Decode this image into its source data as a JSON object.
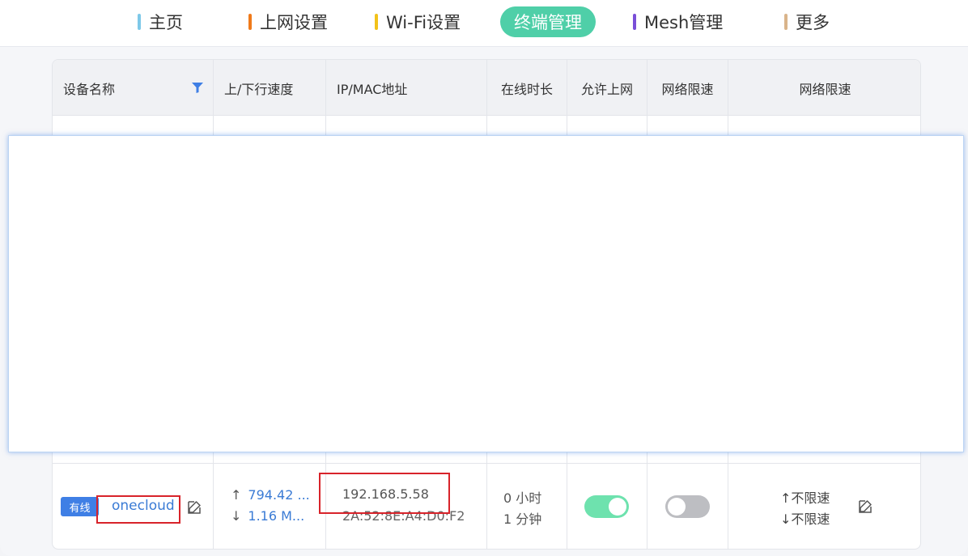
{
  "nav": {
    "items": [
      {
        "label": "主页",
        "color": "#7ec8e8"
      },
      {
        "label": "上网设置",
        "color": "#f07a1a"
      },
      {
        "label": "Wi-Fi设置",
        "color": "#f2c21a"
      },
      {
        "label": "终端管理",
        "color": "#4fcfa8",
        "active": true
      },
      {
        "label": "Mesh管理",
        "color": "#7a4fd8"
      },
      {
        "label": "更多",
        "color": "#d9b48a"
      }
    ]
  },
  "table": {
    "headers": {
      "device_name": "设备名称",
      "speed": "上/下行速度",
      "ip_mac": "IP/MAC地址",
      "online_time": "在线时长",
      "allow_internet": "允许上网",
      "rate_limit_toggle": "网络限速",
      "rate_limit": "网络限速"
    },
    "row": {
      "connection_tag": "有线",
      "device_name": "onecloud",
      "upload": "794.42 ...",
      "download": "1.16 M...",
      "ip": "192.168.5.58",
      "mac": "2A:52:8E:A4:D0:F2",
      "online_hours": "0 小时",
      "online_minutes": "1 分钟",
      "allow_internet": true,
      "rate_limit_enabled": false,
      "upload_limit": "↑不限速",
      "download_limit": "↓不限速"
    }
  },
  "icons": {
    "filter": "filter-icon",
    "edit": "edit-icon",
    "up_arrow": "↑",
    "down_arrow": "↓"
  }
}
